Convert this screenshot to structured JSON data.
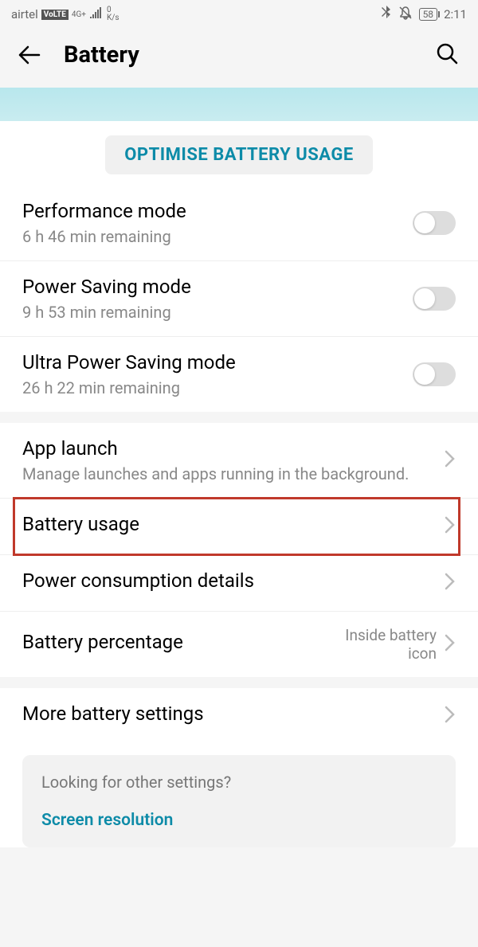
{
  "statusBar": {
    "carrier": "airtel",
    "volte": "VoLTE",
    "network": "4G+",
    "speedTop": "0",
    "speedBottom": "K/s",
    "battery": "58",
    "time": "2:11"
  },
  "header": {
    "title": "Battery"
  },
  "optimiseButton": "OPTIMISE BATTERY USAGE",
  "modes": [
    {
      "title": "Performance mode",
      "subtitle": "6 h 46 min remaining"
    },
    {
      "title": "Power Saving mode",
      "subtitle": "9 h 53 min remaining"
    },
    {
      "title": "Ultra Power Saving mode",
      "subtitle": "26 h 22 min remaining"
    }
  ],
  "items": {
    "appLaunch": {
      "title": "App launch",
      "subtitle": "Manage launches and apps running in the background."
    },
    "batteryUsage": {
      "title": "Battery usage"
    },
    "powerConsumption": {
      "title": "Power consumption details"
    },
    "batteryPercentage": {
      "title": "Battery percentage",
      "value": "Inside battery icon"
    },
    "moreBattery": {
      "title": "More battery settings"
    }
  },
  "infoCard": {
    "question": "Looking for other settings?",
    "link": "Screen resolution"
  }
}
